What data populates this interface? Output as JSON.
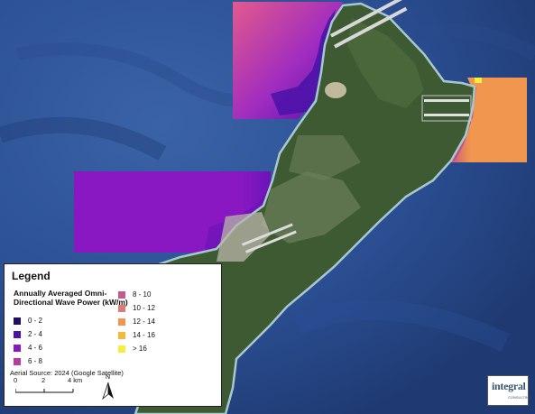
{
  "map": {
    "colors": {
      "deep_ocean": "#233f78",
      "mid_ocean": "#2f58a0",
      "shallow_ocean": "#3e6fb3",
      "land": "#3d5a33",
      "land_light": "#6c7f5a",
      "reef": "#a8c8d0",
      "urban": "#b9b5a8",
      "runway": "#d8d8d8"
    },
    "wave_bins": [
      {
        "label": "0 - 2",
        "color": "#1e0f66"
      },
      {
        "label": "2 - 4",
        "color": "#4a12a8"
      },
      {
        "label": "4 - 6",
        "color": "#8a18c2"
      },
      {
        "label": "6 - 8",
        "color": "#b53c9e"
      },
      {
        "label": "8 - 10",
        "color": "#c45a8a"
      },
      {
        "label": "10 - 12",
        "color": "#de7a76"
      },
      {
        "label": "12 - 14",
        "color": "#f0964e"
      },
      {
        "label": "14 - 16",
        "color": "#f4bb3a"
      },
      {
        "label": "> 16",
        "color": "#f4f03a"
      }
    ]
  },
  "legend": {
    "title": "Legend",
    "subtitle": "Annually Averaged Omni-Directional Wave Power (kW/m)"
  },
  "source": "Aerial Source: 2024 (Google Satellite)",
  "scale": {
    "labels": [
      "0",
      "2",
      "4 km"
    ]
  },
  "north_label": "N",
  "logo": {
    "name": "integral",
    "tagline": "CONSULTING"
  }
}
